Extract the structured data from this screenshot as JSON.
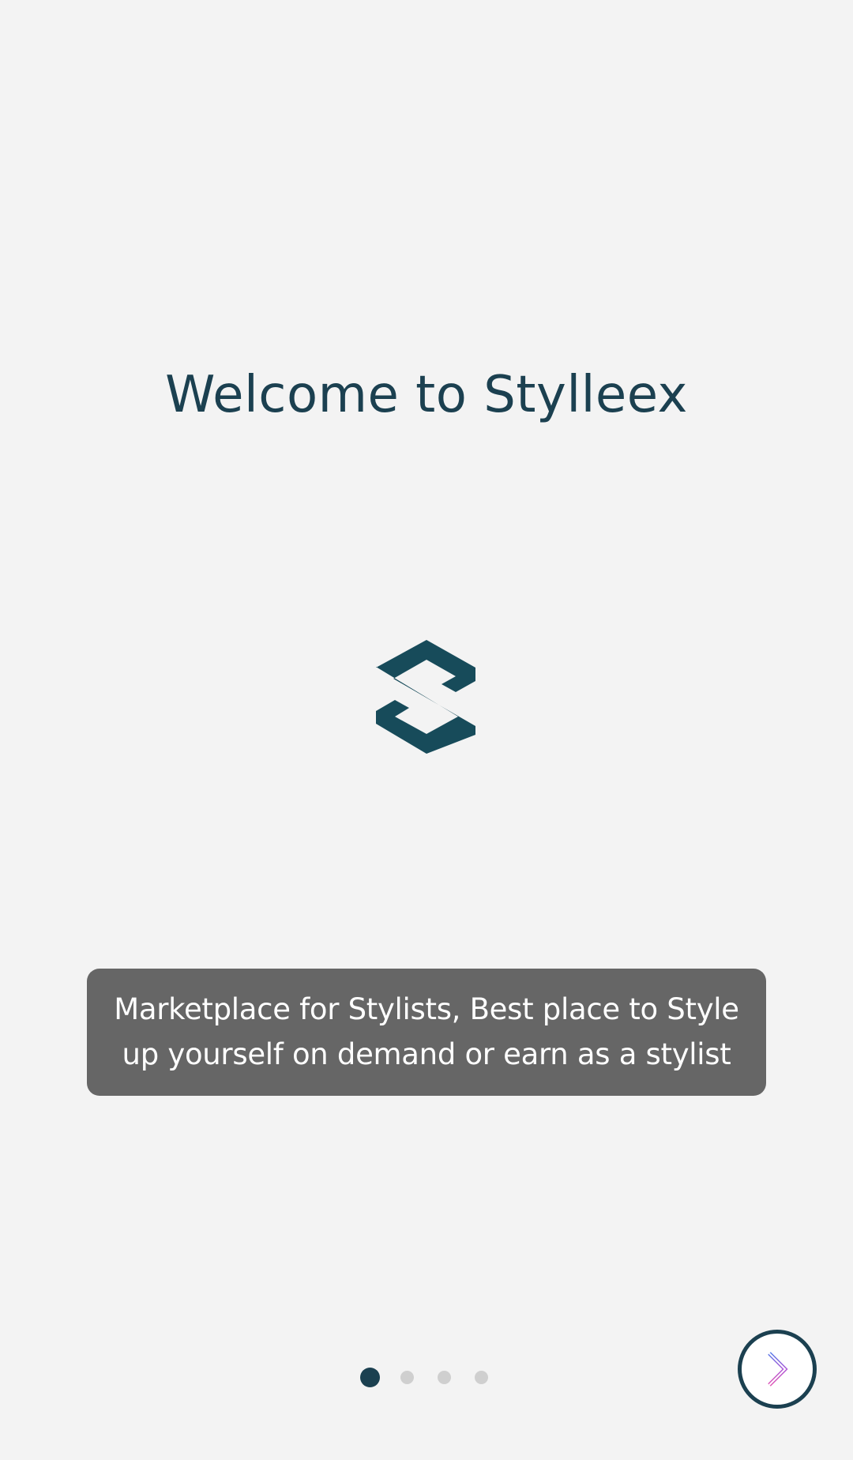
{
  "onboarding": {
    "title": "Welcome to Stylleex",
    "tagline_line1": "Marketplace for Stylists, Best place to Style",
    "tagline_line2": "up yourself on demand or earn as a stylist",
    "logo_icon": "stylleex-s-logo-icon",
    "next_icon": "chevron-right-icon"
  },
  "pagination": {
    "total_pages": 4,
    "current_page": 1
  },
  "colors": {
    "background": "#f3f3f3",
    "primary": "#1b4050",
    "tagline_bg": "#666666",
    "dot_inactive": "#cfcfcf"
  }
}
